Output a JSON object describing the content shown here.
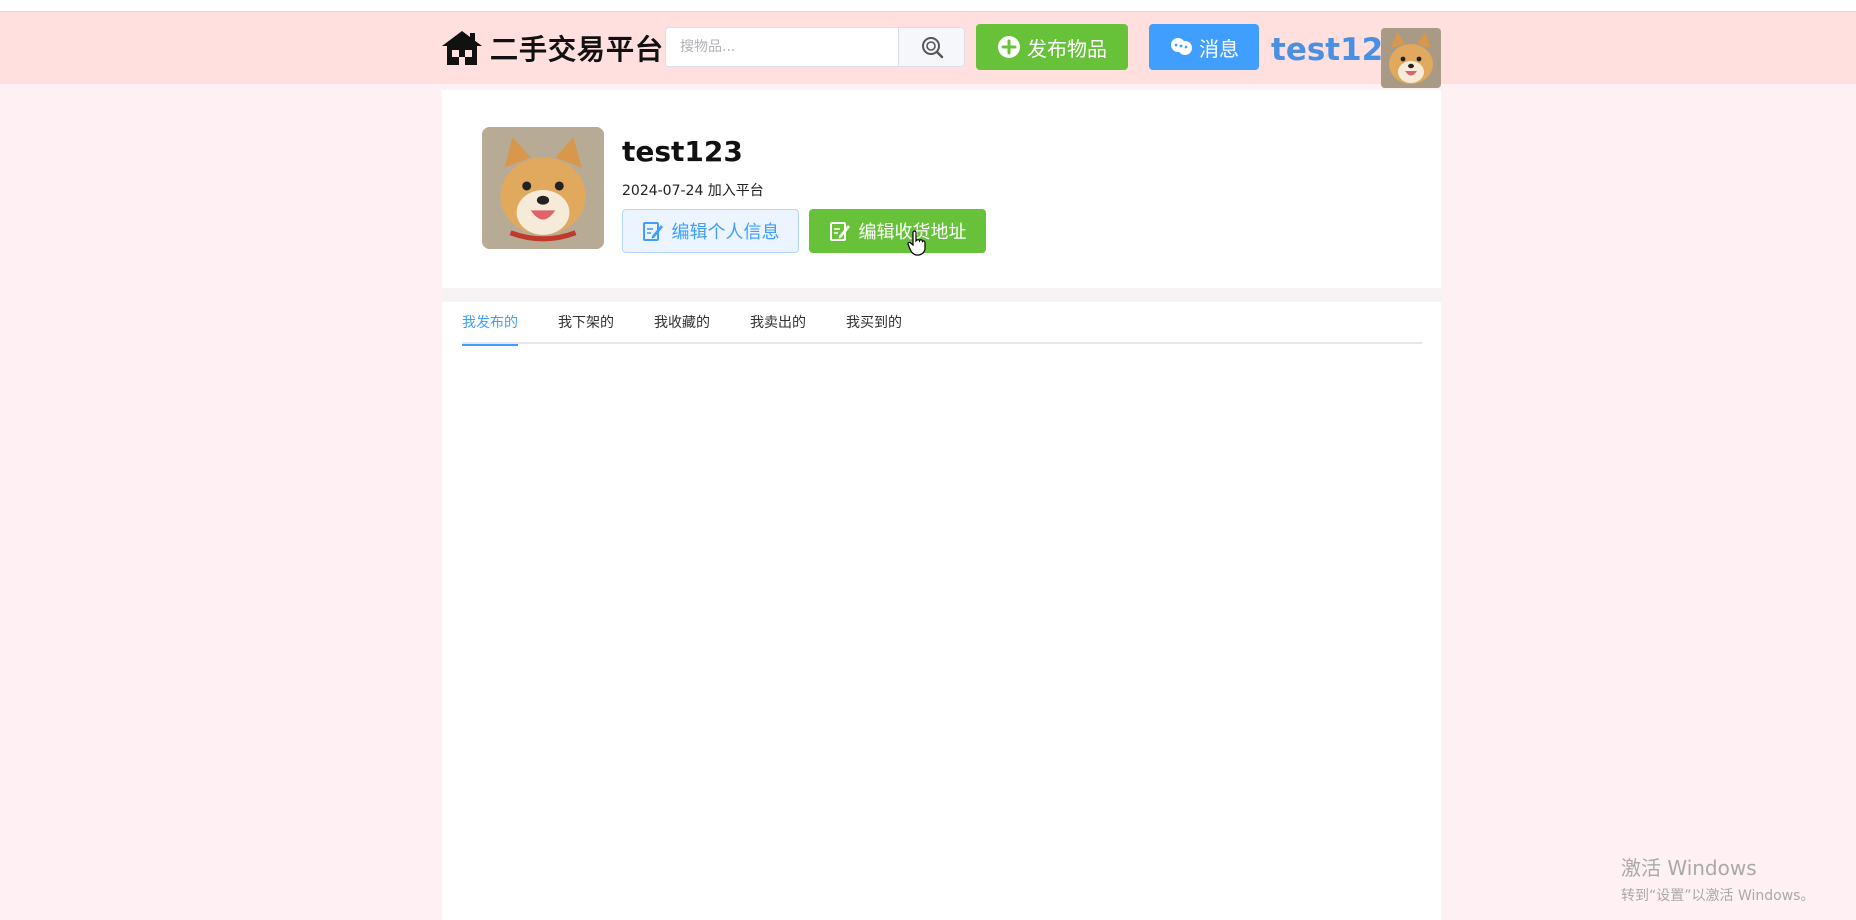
{
  "header": {
    "logo_text": "二手交易平台",
    "search_placeholder": "搜物品...",
    "publish_label": "发布物品",
    "message_label": "消息",
    "username": "test123"
  },
  "profile": {
    "username": "test123",
    "join_text": "2024-07-24 加入平台",
    "edit_info_label": "编辑个人信息",
    "edit_address_label": "编辑收货地址"
  },
  "tabs": [
    {
      "label": "我发布的",
      "active": true
    },
    {
      "label": "我下架的",
      "active": false
    },
    {
      "label": "我收藏的",
      "active": false
    },
    {
      "label": "我卖出的",
      "active": false
    },
    {
      "label": "我买到的",
      "active": false
    }
  ],
  "watermark": {
    "title": "激活 Windows",
    "subtitle": "转到“设置”以激活 Windows。"
  },
  "colors": {
    "header_bg": "#ffe0df",
    "page_bg": "#fff0f3",
    "primary": "#409eff",
    "success": "#67c23a"
  }
}
